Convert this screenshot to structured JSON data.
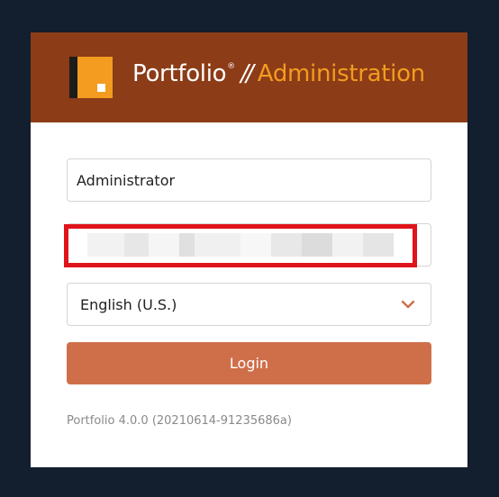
{
  "header": {
    "brand_name": "Portfolio",
    "registered_mark": "®",
    "separator": "//",
    "section": "Administration",
    "colors": {
      "background": "#8c3c17",
      "accent": "#f39c1f"
    }
  },
  "form": {
    "username": {
      "value": "Administrator",
      "placeholder": ""
    },
    "password": {
      "value": "",
      "placeholder": ""
    },
    "language": {
      "selected": "English (U.S.)",
      "icon": "chevron-down-icon"
    },
    "login_label": "Login"
  },
  "footer": {
    "version": "Portfolio 4.0.0 (20210614-91235686a)"
  },
  "colors": {
    "page_background": "#131e2e",
    "button": "#cf6f4a",
    "highlight": "#e0141b"
  }
}
